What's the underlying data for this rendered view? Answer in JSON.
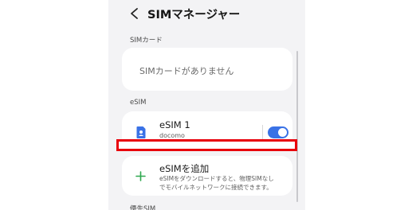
{
  "header": {
    "back_icon": "chevron-left-icon",
    "title": "SIMマネージャー"
  },
  "sections": {
    "sim_card_label": "SIMカード",
    "esim_label": "eSIM",
    "preferred_label": "優先SIM"
  },
  "sim_card": {
    "empty_text": "SIMカードがありません"
  },
  "esim": {
    "icon": "sim-card-icon",
    "name": "eSIM 1",
    "carrier": "docomo",
    "toggle_on": true,
    "accent_color": "#3a72e6"
  },
  "add_esim": {
    "icon": "plus-icon",
    "title": "eSIMを追加",
    "description_line1": "eSIMをダウンロードすると、物理SIMなし",
    "description_line2": "でモバイルネットワークに接続できます。",
    "accent_color": "#2fa84f"
  },
  "highlight_color": "#e8000b"
}
